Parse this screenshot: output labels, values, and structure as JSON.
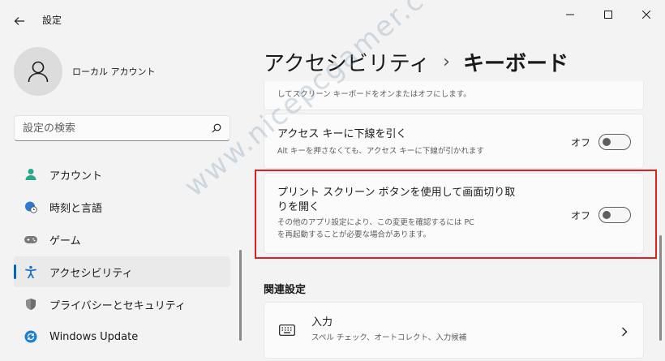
{
  "window": {
    "title": "設定"
  },
  "profile": {
    "name": "ローカル アカウント"
  },
  "search": {
    "placeholder": "設定の検索"
  },
  "sidebar": {
    "items": [
      {
        "label": "アカウント",
        "icon": "person-icon"
      },
      {
        "label": "時刻と言語",
        "icon": "globe-clock-icon"
      },
      {
        "label": "ゲーム",
        "icon": "gamepad-icon"
      },
      {
        "label": "アクセシビリティ",
        "icon": "accessibility-icon",
        "selected": true
      },
      {
        "label": "プライバシーとセキュリティ",
        "icon": "shield-icon"
      },
      {
        "label": "Windows Update",
        "icon": "update-icon"
      }
    ]
  },
  "breadcrumb": {
    "parent": "アクセシビリティ",
    "separator": "›",
    "current": "キーボード"
  },
  "settings": {
    "top_desc": "してスクリーン キーボードをオンまたはオフにします。",
    "access_key": {
      "title": "アクセス キーに下線を引く",
      "desc": "Alt キーを押さなくても、アクセス キーに下線が引かれます",
      "state": "オフ",
      "on": false
    },
    "print_screen": {
      "title_line1": "プリント スクリーン ボタンを使用して画面切り取",
      "title_line2": "りを開く",
      "desc_line1": "その他のアプリ設定により、この変更を確認するには PC",
      "desc_line2": "を再起動することが必要な場合があります。",
      "state": "オフ",
      "on": false
    }
  },
  "related": {
    "header": "関連設定",
    "input": {
      "title": "入力",
      "desc": "スペル チェック、オートコレクト、入力候補"
    }
  },
  "watermark": "www.nicepcgamer.com",
  "colors": {
    "accent": "#0067c0",
    "highlight": "#e02020"
  }
}
